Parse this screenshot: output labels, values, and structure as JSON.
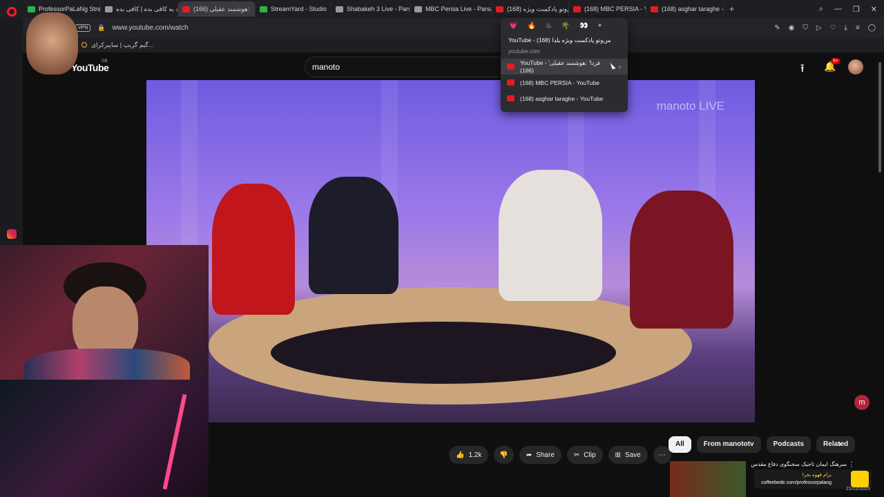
{
  "tabs": [
    {
      "label": "ProfessorPaLaNg Stream",
      "favicon": "green",
      "active": false
    },
    {
      "label": "ورود به کافی بده | کافی بده",
      "favicon": "gray",
      "active": false
    },
    {
      "label": "(166) هوشمند عقیلی:",
      "favicon": "yt",
      "active": true,
      "close": "×"
    },
    {
      "label": "StreamYard - Studio",
      "favicon": "green",
      "active": false
    },
    {
      "label": "Shabakeh 3 Live - Pars",
      "favicon": "gray",
      "active": false
    },
    {
      "label": "MBC Persia Live - Parsa TV",
      "favicon": "gray",
      "active": false
    },
    {
      "label": "(168) من‌وتو پادکست ویژه",
      "favicon": "yt",
      "active": false
    },
    {
      "label": "(168) MBC PERSIA - YouTu",
      "favicon": "yt",
      "active": false
    },
    {
      "label": "(168) asghar taraghe - You",
      "favicon": "yt",
      "active": false
    }
  ],
  "tab_new": "+",
  "window_controls": {
    "search": "⌕",
    "minimize": "—",
    "restore": "❐",
    "close": "✕"
  },
  "address": {
    "vpn": "VPN",
    "lock": "🔒",
    "url": "www.youtube.com/watch"
  },
  "bookmark": {
    "label": "گیم گریپ | سایبرکرای..."
  },
  "youtube": {
    "menu": "☰",
    "logo": "YouTube",
    "region": "GB",
    "search_value": "manoto",
    "upload": "⭱",
    "bell": "🔔",
    "notifications": "9+"
  },
  "video": {
    "watermark_brand": "manoto",
    "watermark_live": "LIVE"
  },
  "actions": {
    "like_icon": "👍",
    "like_count": "1.2k",
    "dislike_icon": "👎",
    "share_icon": "➦",
    "share_label": "Share",
    "clip_icon": "✂",
    "clip_label": "Clip",
    "save_icon": "⊞",
    "save_label": "Save",
    "more_icon": "⋯"
  },
  "chips": [
    "All",
    "From manototv",
    "Podcasts",
    "Related"
  ],
  "chips_next": "›",
  "related": {
    "title": "سرهنگ ایمان تاجیک سخنگوی دفاع مقدس",
    "more": "⋮"
  },
  "coffee": {
    "label_fa": "برام قهوه بخرا",
    "url": "coffeebede.com/professorpalang"
  },
  "date_partial": "21/12/2025",
  "popup": {
    "icons": [
      "💗",
      "🔥",
      "♨",
      "🌴",
      "👀",
      "+"
    ],
    "title": "YouTube - من‌وتو پادکست ویژه یلدا (168)",
    "host": "youtube.com",
    "items": [
      {
        "label": "YouTube - 'فردا' :هوشمند عقیلی (166)",
        "selected": true,
        "close": "×"
      },
      {
        "label": "(168) MBC PERSIA - YouTube",
        "selected": false
      },
      {
        "label": "(168) asghar taraghe - YouTube",
        "selected": false
      }
    ]
  },
  "manoto_button": "m",
  "colors": {
    "youtube_red": "#e31b23",
    "brand_badge": "#cc0000",
    "chip_selected": "#f1f1f1"
  }
}
